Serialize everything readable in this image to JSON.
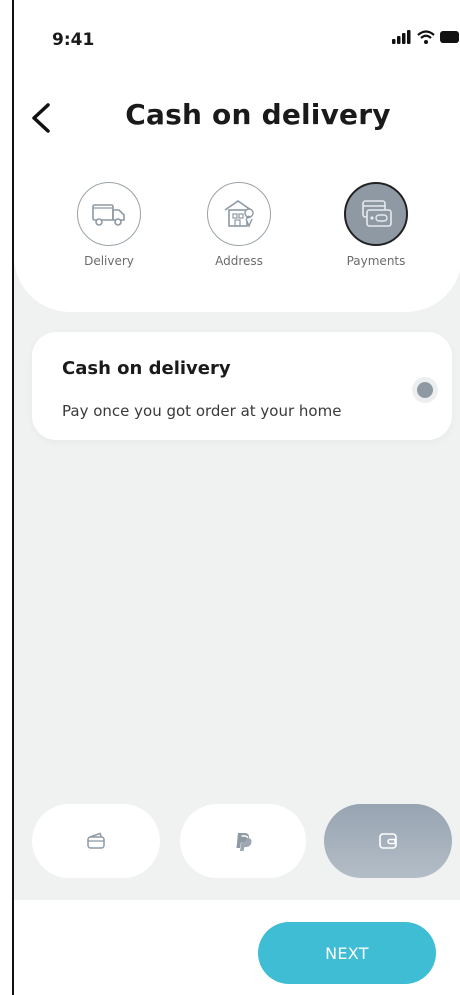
{
  "status_bar": {
    "time": "9:41"
  },
  "header": {
    "title": "Cash on delivery"
  },
  "steps": [
    {
      "label": "Delivery",
      "icon": "truck-icon"
    },
    {
      "label": "Address",
      "icon": "location-building-icon"
    },
    {
      "label": "Payments",
      "icon": "card-icon",
      "active": true
    }
  ],
  "payment_option": {
    "title": "Cash on delivery",
    "description": "Pay once you got order at your home",
    "selected": true
  },
  "methods": [
    {
      "icon": "card-outline-icon"
    },
    {
      "icon": "paypal-icon"
    },
    {
      "icon": "wallet-icon",
      "active": true
    }
  ],
  "footer": {
    "next_label": "NEXT"
  },
  "colors": {
    "accent": "#3ebdd4",
    "active_step": "#8e99a4",
    "background": "#f0f1f1"
  }
}
